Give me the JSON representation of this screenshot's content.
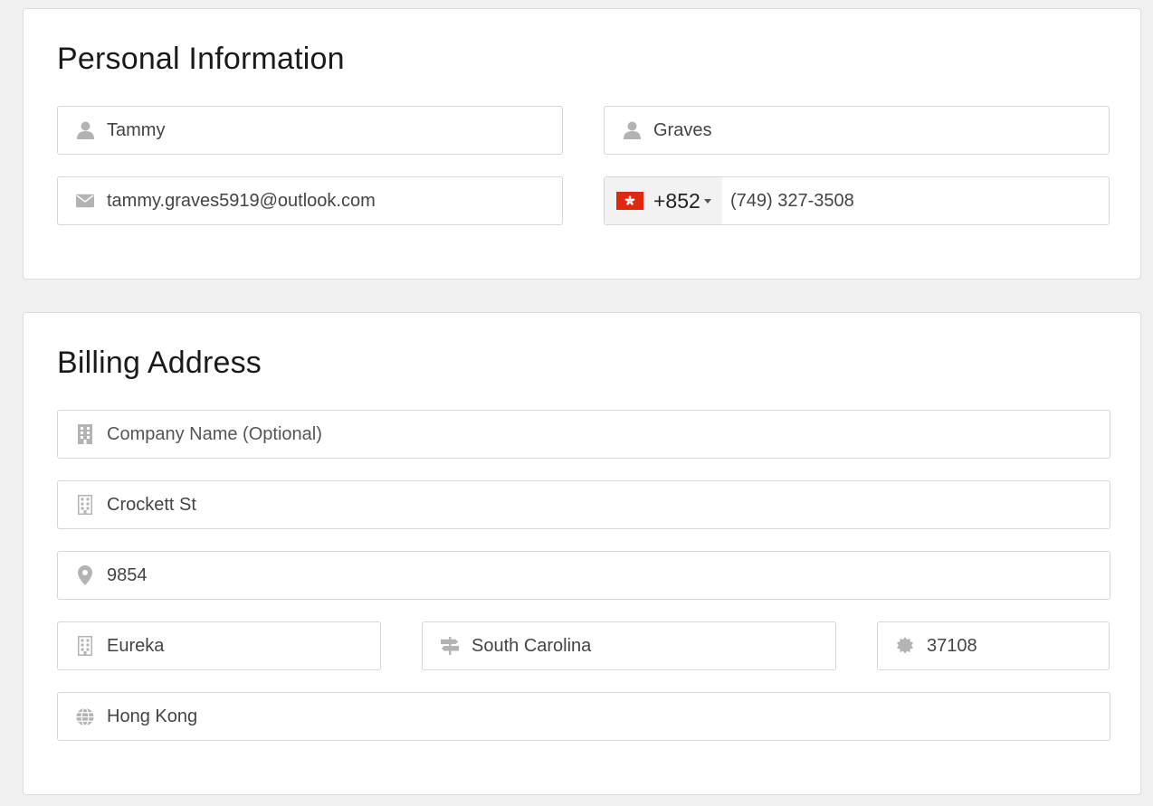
{
  "personal": {
    "title": "Personal Information",
    "first_name": {
      "value": "Tammy",
      "icon": "user-icon"
    },
    "last_name": {
      "value": "Graves",
      "icon": "user-icon"
    },
    "email": {
      "value": "tammy.graves5919@outlook.com",
      "icon": "envelope-icon"
    },
    "phone": {
      "flag": "hong-kong-flag-icon",
      "dial_code": "+852",
      "value": "(749) 327-3508"
    }
  },
  "billing": {
    "title": "Billing Address",
    "company": {
      "placeholder": "Company Name (Optional)",
      "icon": "building-icon"
    },
    "street": {
      "value": "Crockett St",
      "icon": "building-icon"
    },
    "number": {
      "value": "9854",
      "icon": "map-marker-icon"
    },
    "city": {
      "value": "Eureka",
      "icon": "building-icon"
    },
    "state": {
      "value": "South Carolina",
      "icon": "signpost-icon"
    },
    "zip": {
      "value": "37108",
      "icon": "seal-icon"
    },
    "country": {
      "value": "Hong Kong",
      "icon": "globe-icon"
    }
  },
  "colors": {
    "page_background": "#f0f0f0",
    "icon_gray": "#b3b3b3",
    "flag_red": "#de2910"
  }
}
